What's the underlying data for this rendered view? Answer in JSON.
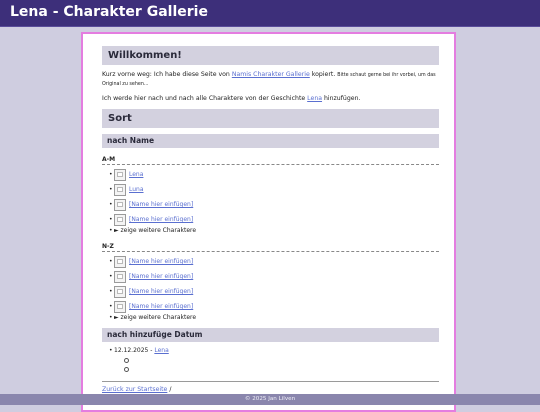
{
  "header": {
    "title": "Lena - Charakter Gallerie"
  },
  "welcome": {
    "heading": "Willkommen!",
    "line1_prefix": "Kurz vorne weg: Ich habe diese Seite von ",
    "line1_link": "Namis Charakter Gallerie",
    "line1_suffix": " kopiert.",
    "line1_small": "Bitte schaut gerne bei ihr vorbei, um das Original zu sehen...",
    "line2_prefix": "Ich werde hier nach und nach alle Charaktere von der Geschichte ",
    "line2_link": "Lena",
    "line2_suffix": " hinzufügen."
  },
  "sort": {
    "heading": "Sort",
    "by_name": "nach Name",
    "group_am": {
      "label": "A-M",
      "items": [
        "Lena",
        "Luna",
        "[Name hier einfügen]",
        "[Name hier einfügen]"
      ],
      "more": "► zeige weitere Charaktere"
    },
    "group_nz": {
      "label": "N-Z",
      "items": [
        "[Name hier einfügen]",
        "[Name hier einfügen]",
        "[Name hier einfügen]",
        "[Name hier einfügen]"
      ],
      "more": "► zeige weitere Charaktere"
    },
    "by_date": "nach hinzufüge Datum",
    "date_entry": {
      "date": "12.12.2025 - ",
      "link": "Lena"
    }
  },
  "back": {
    "link": "Zurück zur Startseite",
    "sep": " /"
  },
  "footer": {
    "text": "© 2025 Jan Lilven"
  },
  "icons": {
    "bullet": "bullet-dot",
    "sub_bullet": "circle-bullet",
    "thumb": "broken-image-icon"
  },
  "colors": {
    "topbar": "#3d2f7a",
    "background": "#cfcde0",
    "border": "#e47de0",
    "link": "#5a6fd0"
  }
}
